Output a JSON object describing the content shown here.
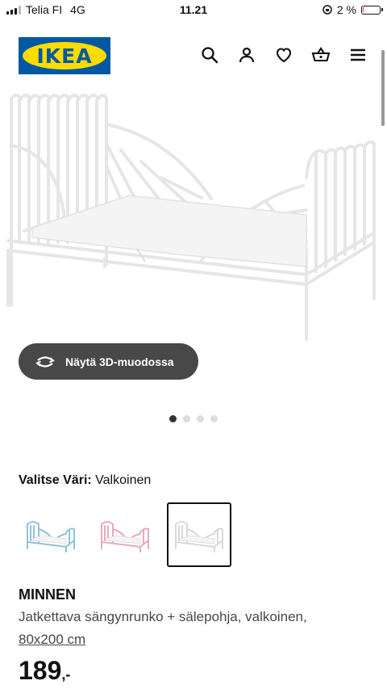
{
  "status_bar": {
    "carrier": "Telia FI",
    "network": "4G",
    "time": "11.21",
    "battery_percent": "2 %",
    "battery_level": 0.02
  },
  "header": {
    "logo_text": "IKEA",
    "icons": [
      "search-icon",
      "user-icon",
      "heart-icon",
      "basket-icon",
      "menu-icon"
    ]
  },
  "view_3d_button": "Näytä 3D-muodossa",
  "carousel": {
    "total": 4,
    "active_index": 0
  },
  "color": {
    "label": "Valitse Väri:",
    "value": "Valkoinen",
    "swatches": [
      {
        "name": "light-blue",
        "color": "#8fc3d6"
      },
      {
        "name": "pink",
        "color": "#e6a9c0"
      },
      {
        "name": "white",
        "color": "#d8d8d8",
        "selected": true
      }
    ]
  },
  "product": {
    "name": "MINNEN",
    "description": "Jatkettava sängynrunko + sälepohja, valkoinen,",
    "size": "80x200 cm",
    "price": "189",
    "price_suffix": ",-"
  },
  "colors": {
    "ikea_blue": "#0058a3",
    "ikea_yellow": "#ffdb00",
    "button_bg": "#484848"
  }
}
